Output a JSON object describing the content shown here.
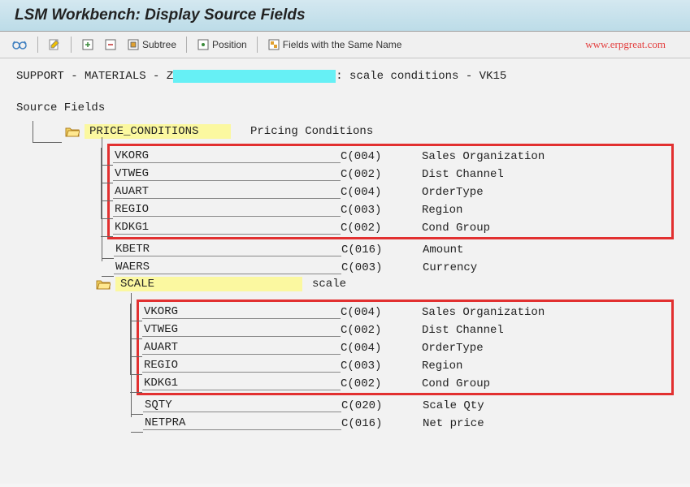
{
  "title": "LSM Workbench: Display Source Fields",
  "toolbar": {
    "subtree_label": "Subtree",
    "position_label": "Position",
    "same_name_label": "Fields with the Same Name"
  },
  "watermark": "www.erpgreat.com",
  "breadcrumb": {
    "part1": "SUPPORT - MATERIALS - Z",
    "part2": ": scale conditions - VK15"
  },
  "tree_root_label": "Source Fields",
  "node1": {
    "name": "PRICE_CONDITIONS",
    "desc": "Pricing Conditions",
    "redbox_fields": [
      {
        "name": "VKORG",
        "type": "C(004)",
        "desc": "Sales Organization"
      },
      {
        "name": "VTWEG",
        "type": "C(002)",
        "desc": "Dist Channel"
      },
      {
        "name": "AUART",
        "type": "C(004)",
        "desc": "OrderType"
      },
      {
        "name": "REGIO",
        "type": "C(003)",
        "desc": "Region"
      },
      {
        "name": "KDKG1",
        "type": "C(002)",
        "desc": "Cond Group"
      }
    ],
    "other_fields": [
      {
        "name": "KBETR",
        "type": "C(016)",
        "desc": "Amount"
      },
      {
        "name": "WAERS",
        "type": "C(003)",
        "desc": "Currency"
      }
    ]
  },
  "node2": {
    "name": "SCALE",
    "desc": "scale",
    "redbox_fields": [
      {
        "name": "VKORG",
        "type": "C(004)",
        "desc": "Sales Organization"
      },
      {
        "name": "VTWEG",
        "type": "C(002)",
        "desc": "Dist Channel"
      },
      {
        "name": "AUART",
        "type": "C(004)",
        "desc": "OrderType"
      },
      {
        "name": "REGIO",
        "type": "C(003)",
        "desc": "Region"
      },
      {
        "name": "KDKG1",
        "type": "C(002)",
        "desc": "Cond Group"
      }
    ],
    "other_fields": [
      {
        "name": "SQTY",
        "type": "C(020)",
        "desc": "Scale Qty"
      },
      {
        "name": "NETPRA",
        "type": "C(016)",
        "desc": "Net price"
      }
    ]
  }
}
